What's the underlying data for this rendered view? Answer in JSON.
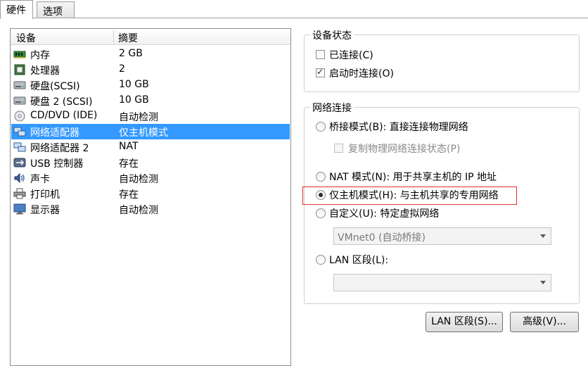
{
  "tabs": [
    {
      "label": "硬件",
      "active": true
    },
    {
      "label": "选项",
      "active": false
    }
  ],
  "device_list": {
    "col_device": "设备",
    "col_summary": "摘要",
    "rows": [
      {
        "icon": "memory-icon",
        "device": "内存",
        "summary": "2 GB"
      },
      {
        "icon": "processor-icon",
        "device": "处理器",
        "summary": "2"
      },
      {
        "icon": "hard-disk-icon",
        "device": "硬盘(SCSI)",
        "summary": "10 GB"
      },
      {
        "icon": "hard-disk-icon",
        "device": "硬盘 2 (SCSI)",
        "summary": "10 GB"
      },
      {
        "icon": "cd-dvd-icon",
        "device": "CD/DVD (IDE)",
        "summary": "自动检测"
      },
      {
        "icon": "network-adapter-icon",
        "device": "网络适配器",
        "summary": "仅主机模式",
        "selected": true
      },
      {
        "icon": "network-adapter-icon",
        "device": "网络适配器 2",
        "summary": "NAT"
      },
      {
        "icon": "usb-icon",
        "device": "USB 控制器",
        "summary": "存在"
      },
      {
        "icon": "sound-card-icon",
        "device": "声卡",
        "summary": "自动检测"
      },
      {
        "icon": "printer-icon",
        "device": "打印机",
        "summary": "存在"
      },
      {
        "icon": "display-icon",
        "device": "显示器",
        "summary": "自动检测"
      }
    ]
  },
  "device_status": {
    "title": "设备状态",
    "connected_label": "已连接(C)",
    "connected": false,
    "connect_on_start_label": "启动时连接(O)",
    "connect_on_start": true
  },
  "network": {
    "title": "网络连接",
    "bridged_label": "桥接模式(B): 直接连接物理网络",
    "replicate_label": "复制物理网络连接状态(P)",
    "nat_label": "NAT 模式(N): 用于共享主机的 IP 地址",
    "host_only_label": "仅主机模式(H): 与主机共享的专用网络",
    "custom_label": "自定义(U): 特定虚拟网络",
    "custom_value": "VMnet0 (自动桥接)",
    "lan_label": "LAN 区段(L):",
    "lan_value": "",
    "selected": "host_only"
  },
  "buttons": {
    "lan_segments": "LAN 区段(S)...",
    "advanced": "高级(V)..."
  },
  "colors": {
    "selection": "#3399ff",
    "highlight_border": "#e03030"
  }
}
